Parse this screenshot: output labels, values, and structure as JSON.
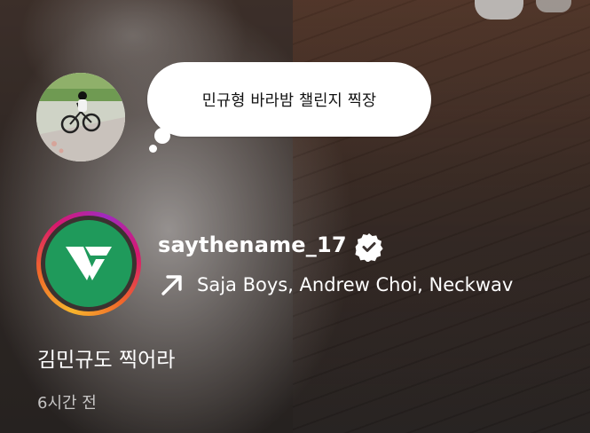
{
  "note": {
    "text": "민규형 바라밤 챌린지 찍장"
  },
  "account": {
    "username": "saythename_17",
    "verified": true,
    "verified_icon": "verified-badge-icon",
    "avatar_brand_color": "#1f9a5b"
  },
  "music": {
    "icon": "arrow-up-right-icon",
    "text": "Saja Boys, Andrew Choi, Neckwav"
  },
  "caption": {
    "text": "김민규도 찍어라"
  },
  "timestamp": {
    "text": "6시간 전"
  },
  "colors": {
    "ring_gradient": [
      "#f7b52c",
      "#f0682a",
      "#d8186e",
      "#a02bbf"
    ],
    "text": "#ffffff",
    "bubble": "#ffffff"
  }
}
